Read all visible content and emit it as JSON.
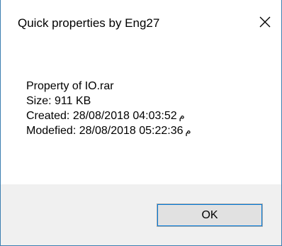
{
  "window": {
    "title": "Quick properties by Eng27",
    "close_icon": "close-icon"
  },
  "info": {
    "name_line": "Property of IO.rar",
    "size_line": "Size: 911 KB",
    "created_line": "Created: 28/08/2018 04:03:52",
    "created_suffix": "م",
    "modified_line": "Modefied: 28/08/2018 05:22:36",
    "modified_suffix": "م"
  },
  "buttons": {
    "ok_label": "OK"
  },
  "colors": {
    "window_border": "#3c7fb1",
    "footer_background": "#f0f0f0",
    "button_background": "#e1e1e1",
    "button_focus": "#0078d7"
  }
}
